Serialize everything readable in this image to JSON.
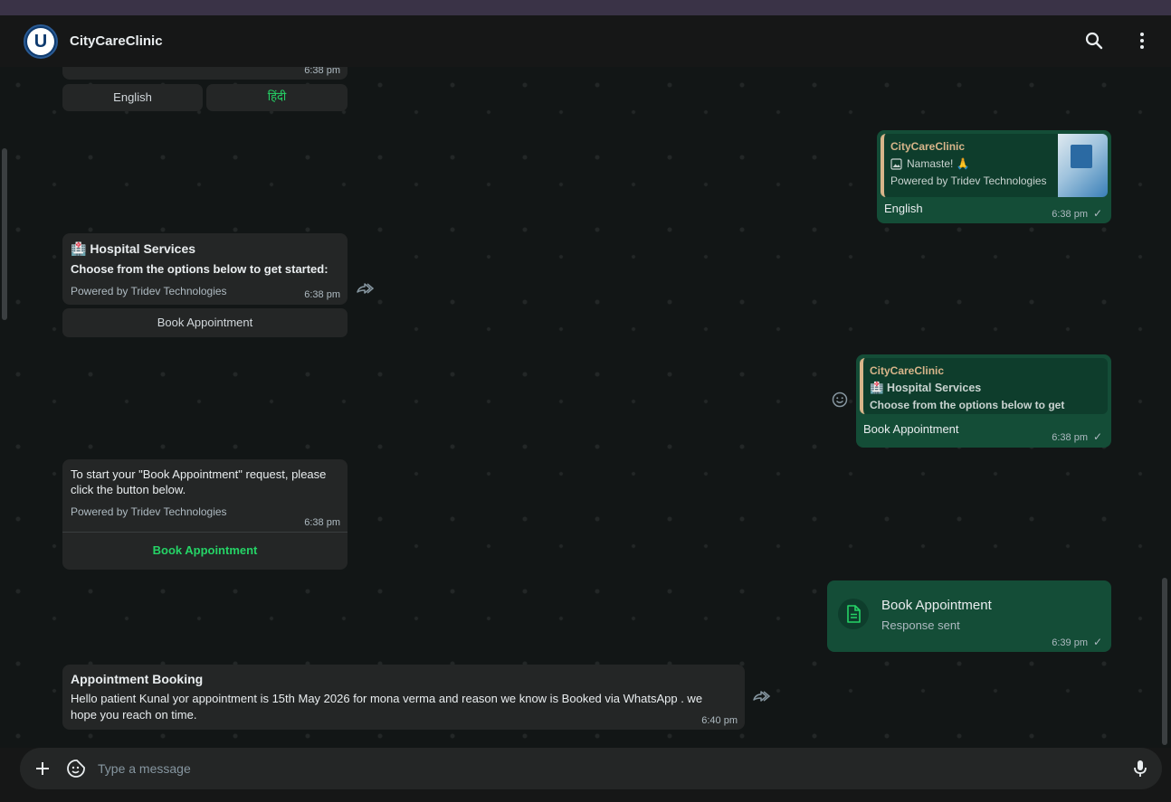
{
  "header": {
    "avatar_letter": "U",
    "title": "CityCareClinic"
  },
  "messages": {
    "m0": {
      "time": "6:38 pm",
      "buttons": [
        "English",
        "हिंदी"
      ]
    },
    "m1": {
      "quote_name": "CityCareClinic",
      "quote_line1": "Namaste! 🙏",
      "quote_line2": "Powered by Tridev Technologies",
      "body": "English",
      "time": "6:38 pm",
      "tick": "✓"
    },
    "m2": {
      "title": "🏥 Hospital Services",
      "subtitle": "Choose from the options below to get started:",
      "powered": "Powered by Tridev Technologies",
      "time": "6:38 pm",
      "button": "Book Appointment"
    },
    "m3": {
      "quote_name": "CityCareClinic",
      "quote_line1": "🏥 Hospital Services",
      "quote_line2": "Choose from the options below to get starte…",
      "body": "Book Appointment",
      "time": "6:38 pm",
      "tick": "✓"
    },
    "m4": {
      "body_line1": "To start your \"Book Appointment\" request, please",
      "body_line2": "click the button below.",
      "powered": "Powered by Tridev Technologies",
      "time": "6:38 pm",
      "button": "Book Appointment"
    },
    "m5": {
      "title": "Book Appointment",
      "subtitle": "Response sent",
      "time": "6:39 pm",
      "tick": "✓"
    },
    "m6": {
      "title": "Appointment Booking",
      "body_line1": "Hello patient Kunal yor appointment is 15th May 2026 for mona verma and reason we know is Booked via WhatsApp . we",
      "body_line2": "hope you reach on time.",
      "time": "6:40 pm"
    }
  },
  "composer": {
    "placeholder": "Type a message"
  },
  "colors": {
    "accent": "#25d366",
    "outgoing_bubble": "#144d37",
    "incoming_bubble": "#242626"
  },
  "icons": [
    "search-icon",
    "menu-icon",
    "forward-icon",
    "emoji-reaction-icon",
    "document-icon",
    "plus-icon",
    "sticker-icon",
    "mic-icon",
    "image-icon"
  ]
}
